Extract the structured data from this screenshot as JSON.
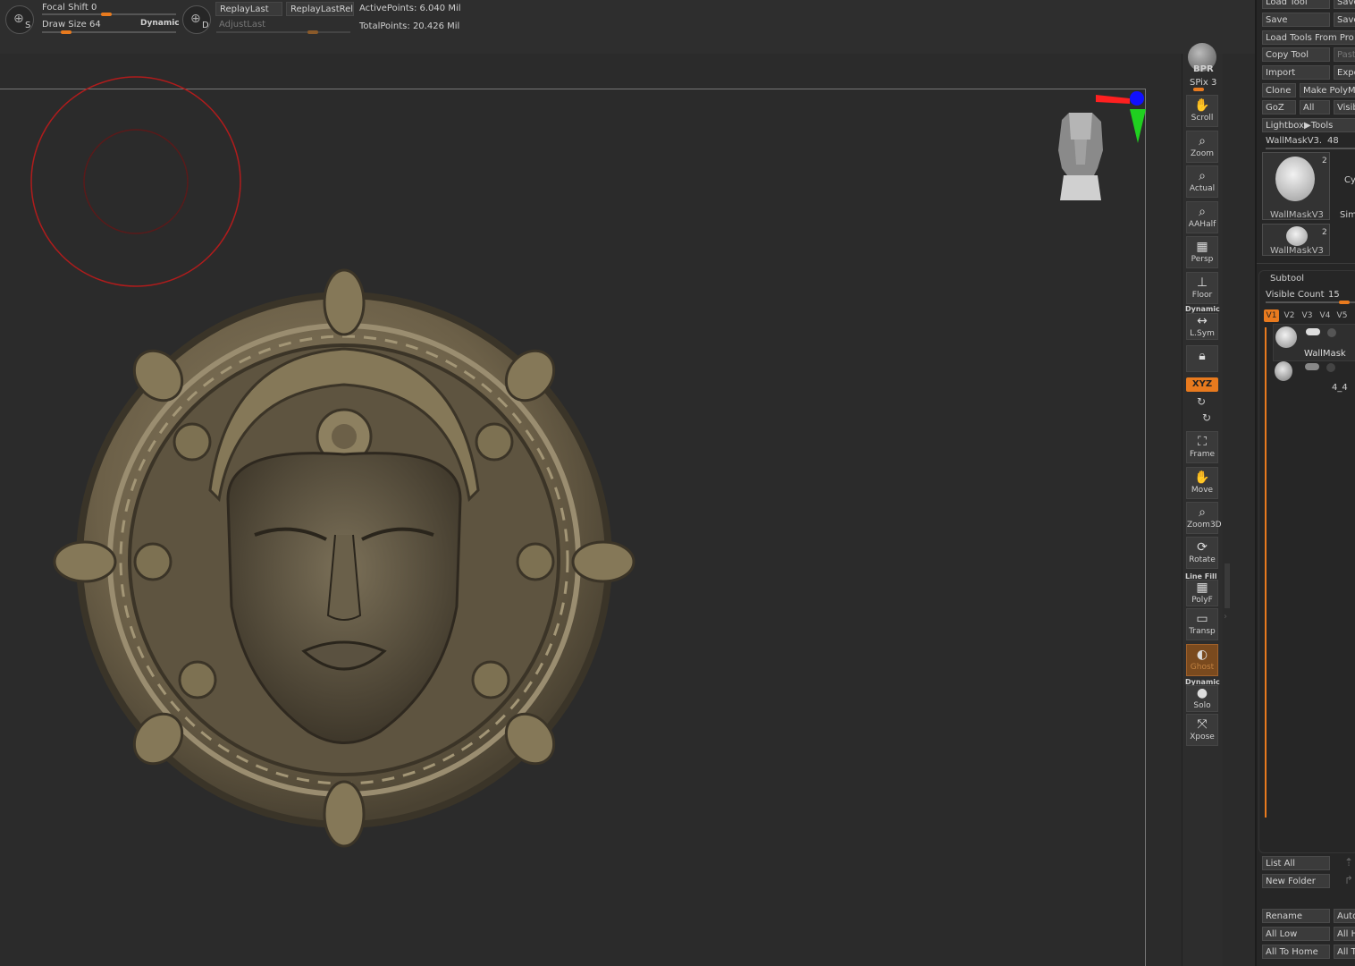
{
  "topbar": {
    "focal_shift_label": "Focal Shift",
    "focal_shift_value": "0",
    "focal_shift_level": 0.0,
    "draw_size_label": "Draw Size",
    "draw_size_value": "64",
    "draw_size_level": 0.05,
    "dynamic_label": "Dynamic",
    "icon_s_letter": "S",
    "icon_d_letter": "D",
    "replay_last": "ReplayLast",
    "replay_last_rel": "ReplayLastRel",
    "adjust_last": "AdjustLast",
    "active_points": "ActivePoints: 6.040 Mil",
    "total_points": "TotalPoints: 20.426 Mil"
  },
  "shelf": {
    "bpr": "BPR",
    "spix": "SPix 3",
    "buttons": [
      {
        "label": "Scroll",
        "icon": "hand-icon"
      },
      {
        "label": "Zoom",
        "icon": "magnifier-icon"
      },
      {
        "label": "Actual",
        "icon": "magnifier-icon"
      },
      {
        "label": "AAHalf",
        "icon": "magnifier-icon"
      },
      {
        "label": "Persp",
        "icon": "grid-icon"
      },
      {
        "label": "Floor",
        "icon": "floor-icon"
      },
      {
        "label": "L.Sym",
        "icon": "arrows-icon"
      }
    ],
    "dynamic_label": "Dynamic",
    "xyz_label": "XYZ",
    "buttons2": [
      {
        "label": "Frame",
        "icon": "frame-icon"
      },
      {
        "label": "Move",
        "icon": "hand-icon"
      },
      {
        "label": "Zoom3D",
        "icon": "magnifier-icon"
      },
      {
        "label": "Rotate",
        "icon": "rotate-icon"
      },
      {
        "label": "PolyF",
        "icon": "grid-icon"
      },
      {
        "label": "Transp",
        "icon": "transparency-icon"
      },
      {
        "label": "Ghost",
        "icon": "ghost-icon"
      },
      {
        "label": "Solo",
        "icon": "solo-icon"
      },
      {
        "label": "Xpose",
        "icon": "xpose-icon"
      }
    ],
    "line_fill_label": "Line Fill"
  },
  "panel": {
    "load_tool": "Load Tool",
    "save_as": "Save",
    "save": "Save",
    "save2": "Save",
    "load_tools_from_project": "Load Tools From Pro",
    "copy_tool": "Copy Tool",
    "paste": "Past",
    "import": "Import",
    "export": "Expo",
    "clone": "Clone",
    "make_polymesh": "Make PolyM",
    "goz": "GoZ",
    "all": "All",
    "visible": "Visib",
    "lightbox_tools": "Lightbox▶Tools",
    "tool_name": "WallMaskV3.",
    "tool_value": "48",
    "thumb1_label": "WallMaskV3",
    "thumb1_count": "2",
    "thumb1_side": "Cyl",
    "thumb1_side2": "Sim",
    "thumb2_label": "WallMaskV3",
    "thumb2_count": "2",
    "subtool_title": "Subtool",
    "visible_count_label": "Visible Count",
    "visible_count_value": "15",
    "tabs": [
      "V1",
      "V2",
      "V3",
      "V4",
      "V5",
      "V"
    ],
    "subtool1_name": "WallMask",
    "subtool2_name": "4_4",
    "list_all": "List All",
    "new_folder": "New Folder",
    "rename": "Rename",
    "auto": "Auto",
    "all_low": "All Low",
    "all_high": "All H",
    "all_to_home": "All To Home",
    "all_t": "All T"
  },
  "colors": {
    "accent": "#e87a1e",
    "brush_circle": "#b01c1c",
    "gizmo_x": "#ff2020",
    "gizmo_y": "#20d020",
    "gizmo_z": "#1010ff"
  }
}
